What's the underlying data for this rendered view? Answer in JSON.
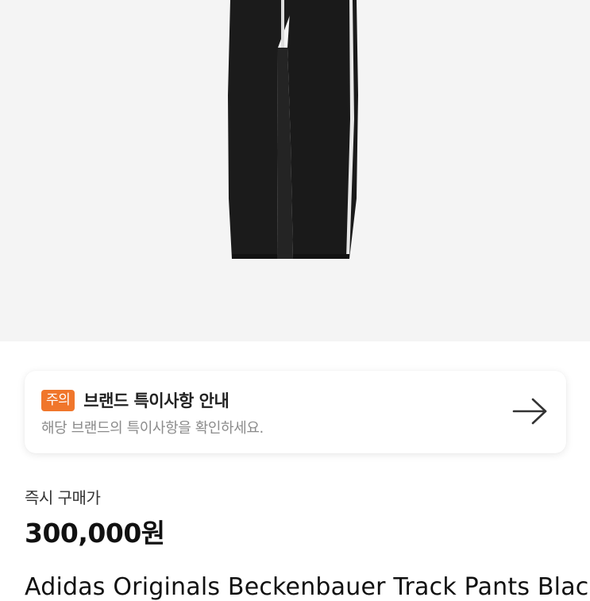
{
  "notice": {
    "badge": "주의",
    "title": "브랜드 특이사항 안내",
    "subtitle": "해당 브랜드의 특이사항을 확인하세요."
  },
  "purchase": {
    "label": "즉시 구매가",
    "price": "300,000원"
  },
  "product": {
    "name": "Adidas Originals Beckenbauer Track Pants Black"
  },
  "icons": {
    "notice_arrow": "arrow-right-icon"
  },
  "colors": {
    "badge": "#f0762b",
    "hero_background": "#f4f4f4",
    "pants": "#1b1b1b",
    "stripe": "#e8e8e8"
  }
}
